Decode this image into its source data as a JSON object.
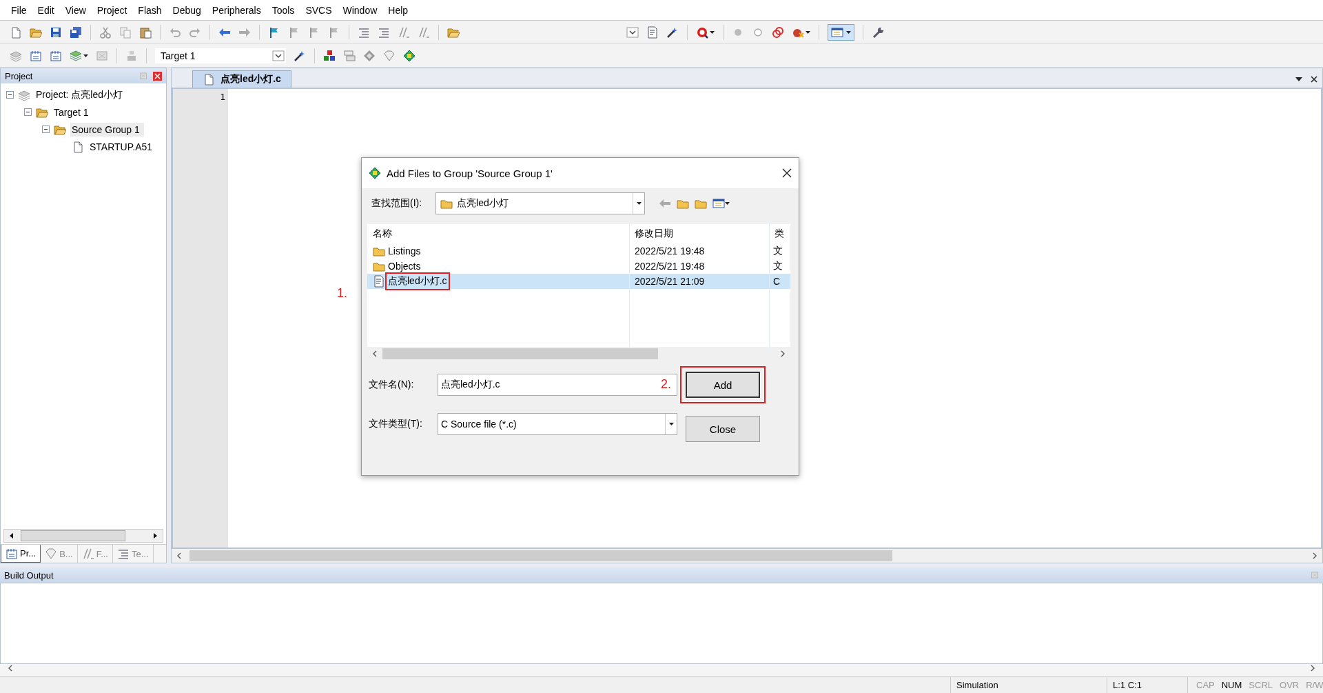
{
  "menu": [
    "File",
    "Edit",
    "View",
    "Project",
    "Flash",
    "Debug",
    "Peripherals",
    "Tools",
    "SVCS",
    "Window",
    "Help"
  ],
  "toolbar": {
    "target": "Target 1"
  },
  "project_panel": {
    "title": "Project",
    "tree": [
      {
        "label": "Project: 点亮led小灯",
        "kind": "project",
        "expanded": true,
        "selected": false,
        "children": [
          {
            "label": "Target 1",
            "kind": "target",
            "expanded": true,
            "selected": false,
            "children": [
              {
                "label": "Source Group 1",
                "kind": "group",
                "expanded": true,
                "selected": true,
                "children": [
                  {
                    "label": "STARTUP.A51",
                    "kind": "file",
                    "selected": false
                  }
                ]
              }
            ]
          }
        ]
      }
    ],
    "tabs": [
      {
        "label": "Pr...",
        "kind": "project",
        "selected": true
      },
      {
        "label": "B...",
        "kind": "books",
        "selected": false
      },
      {
        "label": "F...",
        "kind": "functions",
        "selected": false
      },
      {
        "label": "Te...",
        "kind": "templates",
        "selected": false
      }
    ]
  },
  "editor": {
    "tabs": [
      {
        "label": "点亮led小灯.c",
        "selected": true
      }
    ],
    "line_numbers": [
      "1"
    ]
  },
  "dialog": {
    "title": "Add Files to Group 'Source Group 1'",
    "look_in_label": "查找范围(I):",
    "look_in": "点亮led小灯",
    "columns": [
      "名称",
      "修改日期",
      "类"
    ],
    "files": [
      {
        "name": "Listings",
        "date": "2022/5/21 19:48",
        "column_3": "文",
        "kind": "folder",
        "selected": false
      },
      {
        "name": "Objects",
        "date": "2022/5/21 19:48",
        "column_3": "文",
        "kind": "folder",
        "selected": false
      },
      {
        "name": "点亮led小灯.c",
        "date": "2022/5/21 21:09",
        "column_3": "C",
        "kind": "c-file",
        "selected": true
      }
    ],
    "file_name_label": "文件名(N):",
    "file_name": "点亮led小灯.c",
    "file_type_label": "文件类型(T):",
    "file_type": "C Source file (*.c)",
    "buttons": [
      "Add",
      "Close"
    ],
    "annotations": [
      "1.",
      "2."
    ]
  },
  "output": {
    "title": "Build Output"
  },
  "status_bar": {
    "mode": "Simulation",
    "position": "L:1 C:1",
    "indicators": [
      {
        "label": "CAP",
        "on": false
      },
      {
        "label": "NUM",
        "on": true
      },
      {
        "label": "SCRL",
        "on": false
      },
      {
        "label": "OVR",
        "on": false
      },
      {
        "label": "R/W",
        "on": false
      }
    ]
  }
}
